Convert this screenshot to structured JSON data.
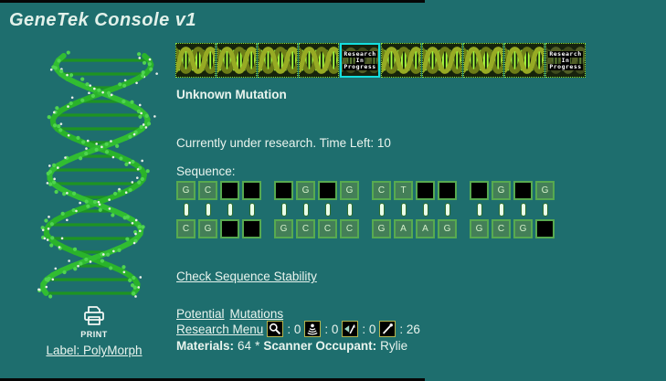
{
  "window": {
    "title": "GeneTek Console v1"
  },
  "colors": {
    "background": "#1e6e6e",
    "text": "#e9f4ee",
    "tile_border": "#8ae43e",
    "selected_tile_border": "#14dede",
    "base_box_fill": "#447f58",
    "base_box_border": "#57aa50",
    "blank_box_fill": "#000000",
    "connector_fill": "#eaffea",
    "icon_box_border": "#b5b54e",
    "icon_box_bg": "#000000"
  },
  "dna_strip": {
    "research_label_lines": [
      "Research",
      "In",
      "Progress"
    ],
    "tiles": [
      {
        "kind": "helix"
      },
      {
        "kind": "helix"
      },
      {
        "kind": "helix"
      },
      {
        "kind": "helix"
      },
      {
        "kind": "research",
        "selected": true
      },
      {
        "kind": "helix"
      },
      {
        "kind": "helix"
      },
      {
        "kind": "helix"
      },
      {
        "kind": "helix"
      },
      {
        "kind": "research",
        "selected": false
      }
    ]
  },
  "mutation": {
    "name": "Unknown Mutation",
    "status": "Currently under research. Time Left: 10"
  },
  "sequence": {
    "label": "Sequence:",
    "groups": [
      {
        "top": [
          "G",
          "C",
          null,
          null
        ],
        "bottom": [
          "C",
          "G",
          null,
          null
        ]
      },
      {
        "top": [
          null,
          "G",
          null,
          "G"
        ],
        "bottom": [
          "G",
          "C",
          "C",
          "C"
        ]
      },
      {
        "top": [
          "C",
          "T",
          null,
          null
        ],
        "bottom": [
          "G",
          "A",
          "A",
          "G"
        ]
      },
      {
        "top": [
          null,
          "G",
          null,
          "G"
        ],
        "bottom": [
          "G",
          "C",
          "G",
          null
        ]
      }
    ]
  },
  "actions": {
    "check_stability": "Check Sequence Stability",
    "potential": "Potential",
    "mutations": "Mutations",
    "research_menu": "Research Menu"
  },
  "research_menu": {
    "separator": ":",
    "items": [
      {
        "icon": "magnifier-icon",
        "count": "0"
      },
      {
        "icon": "beacon-icon",
        "count": "0"
      },
      {
        "icon": "sample-arrow-icon",
        "count": "0"
      },
      {
        "icon": "pipette-icon",
        "count": "26"
      }
    ]
  },
  "status_line": {
    "materials_label": "Materials:",
    "materials_value": "64",
    "separator": "*",
    "occupant_label": "Scanner Occupant:",
    "occupant_value": "Rylie"
  },
  "print": {
    "caption": "PRINT",
    "label_link": "Label: PolyMorph"
  }
}
